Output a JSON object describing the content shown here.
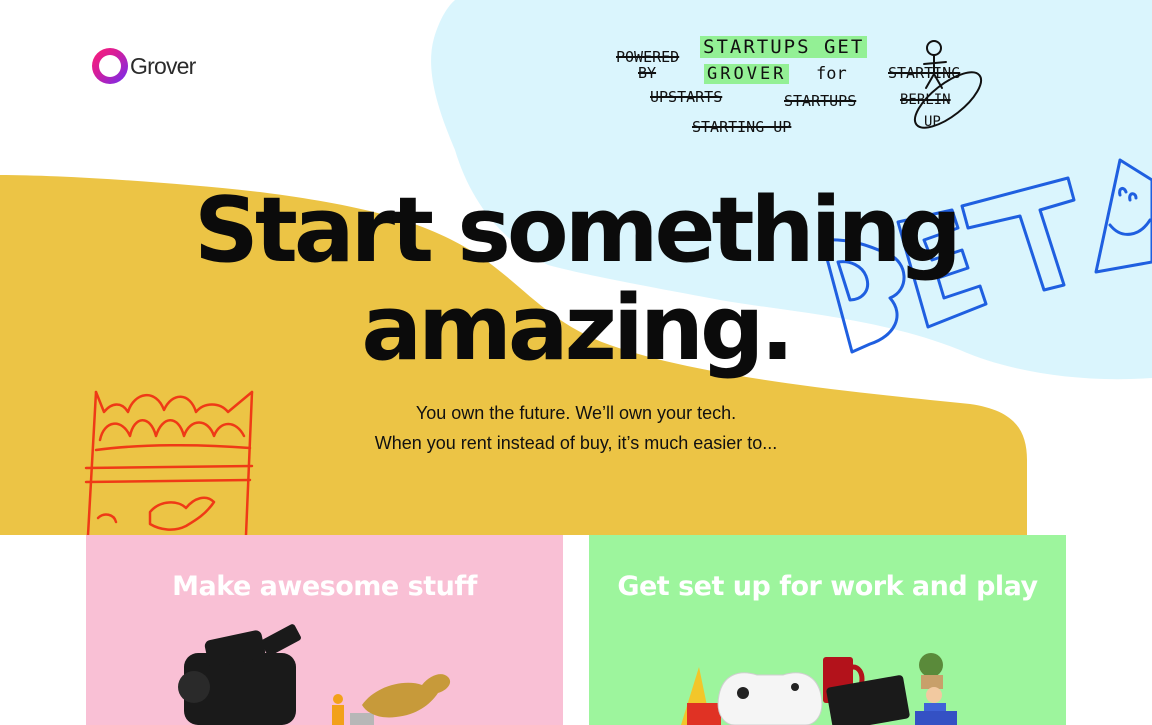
{
  "brand": {
    "name": "Grover",
    "colors": {
      "ring_start": "#ff1f74",
      "ring_end": "#6e2cf4"
    }
  },
  "scribble": {
    "crossed_out": [
      "POWERED BY",
      "UPSTARTS",
      "STARTUPS",
      "STARTING UP",
      "STARTING UP BERLIN"
    ],
    "highlighted": [
      "STARTUPS GET",
      "GROVER"
    ],
    "plain": [
      "FOR"
    ],
    "tokens": {
      "powered": "POWERED",
      "by": "BY",
      "startups_get": "STARTUPS GET",
      "grover": "GROVER",
      "for_word": "for",
      "upstarts": "UPSTARTS",
      "startups": "STARTUPS",
      "starting_up": "STARTING UP",
      "starting": "STARTING",
      "berlin": "BERLIN",
      "up": "UP"
    }
  },
  "beta_label": "BETA",
  "hero": {
    "title_line1": "Start something",
    "title_line2": "amazing.",
    "subtitle_line1": "You own the future. We’ll own your tech.",
    "subtitle_line2": "When you rent instead of buy, it’s much easier to..."
  },
  "cards": [
    {
      "title": "Make awesome stuff",
      "color": "#f9c0d5"
    },
    {
      "title": "Get set up for work and play",
      "color": "#9df59d"
    }
  ],
  "colors": {
    "yellow_blob": "#ecc445",
    "blue_blob": "#daf5fd",
    "beta_blue": "#1f5fe0",
    "crest_red": "#ef3a16",
    "highlight_green": "#93f095"
  }
}
